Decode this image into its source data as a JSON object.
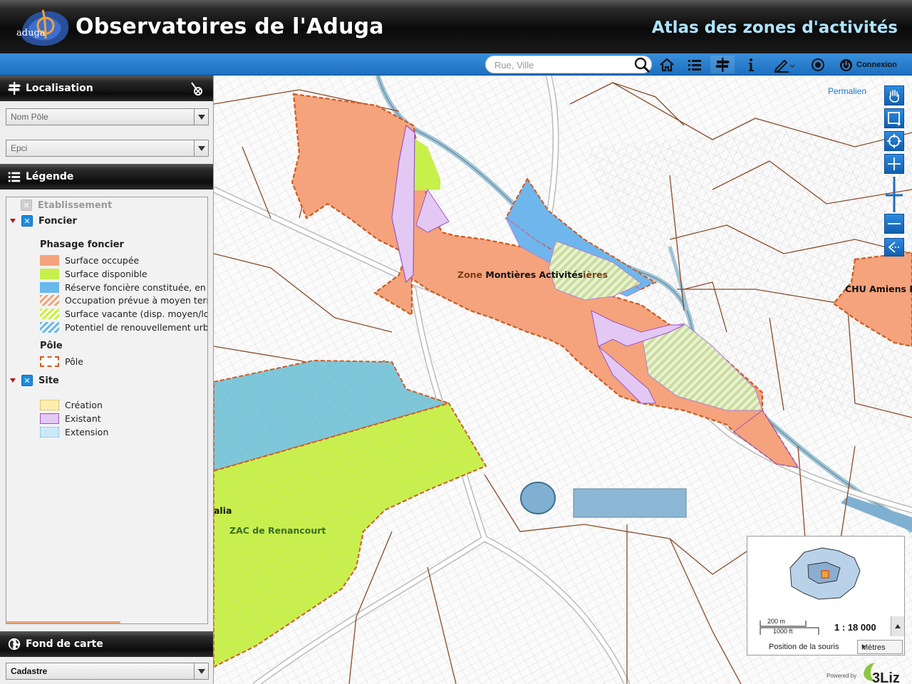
{
  "header": {
    "title": "Observatoires de l'Aduga",
    "subtitle": "Atlas des zones d'activités",
    "logo_text": "aduga"
  },
  "toolbar": {
    "search_placeholder": "Rue, Ville",
    "buttons": [
      "home-icon",
      "layers-list-icon",
      "locate-signpost-icon",
      "info-icon",
      "edit-icon",
      "geolocate-icon"
    ],
    "login_label": "Connexion"
  },
  "panel": {
    "localisation": {
      "title": "Localisation",
      "select_pole": "Nom Pôle",
      "select_epci": "Epci"
    },
    "legend": {
      "title": "Légende",
      "etablissement": "Etablissement",
      "foncier": "Foncier",
      "phasage_title": "Phasage foncier",
      "phasage_items": [
        {
          "label": "Surface occupée",
          "color": "#f4a37c"
        },
        {
          "label": "Surface disponible",
          "color": "#c8f04a"
        },
        {
          "label": "Réserve foncière constituée, en pro",
          "color": "#68b9ee"
        },
        {
          "label": "Occupation prévue à moyen terme",
          "color": "#f4a37c"
        },
        {
          "label": "Surface vacante (disp. moyen/long",
          "color": "#c8f04a"
        },
        {
          "label": "Potentiel de renouvellement urbain",
          "color": "#68b9ee"
        }
      ],
      "pole_title": "Pôle",
      "pole_item": "Pôle",
      "site": "Site",
      "site_items": [
        {
          "label": "Création",
          "color": "#fdeeb0"
        },
        {
          "label": "Existant",
          "color": "#e3c8f4"
        },
        {
          "label": "Extension",
          "color": "#cde9f8"
        }
      ]
    },
    "basemap": {
      "title": "Fond de carte",
      "select_value": "Cadastre"
    }
  },
  "map": {
    "permalink": "Permalien",
    "labels": {
      "zone_prefix": "Zone",
      "montieres": "Montières Activités",
      "montieres_suffix": "ières",
      "chu": "CHU Amiens P",
      "italia": "alia",
      "zac": "ZAC de Renancourt"
    },
    "colors": {
      "occupied": "#f4a37c",
      "available": "#c8f04a",
      "reserve": "#6fb6ec",
      "cyan_zone": "#7cc6d9",
      "pole_border": "#d2591f",
      "parcel": "#8a4a2a"
    },
    "scale": {
      "metric": "200 m",
      "imperial": "1000 ft",
      "ratio": "1 : 18 000",
      "mouse_position_label": "Position de la souris",
      "units": "Mètres"
    },
    "powered_by": "Powered by",
    "brand": "3Liz"
  }
}
